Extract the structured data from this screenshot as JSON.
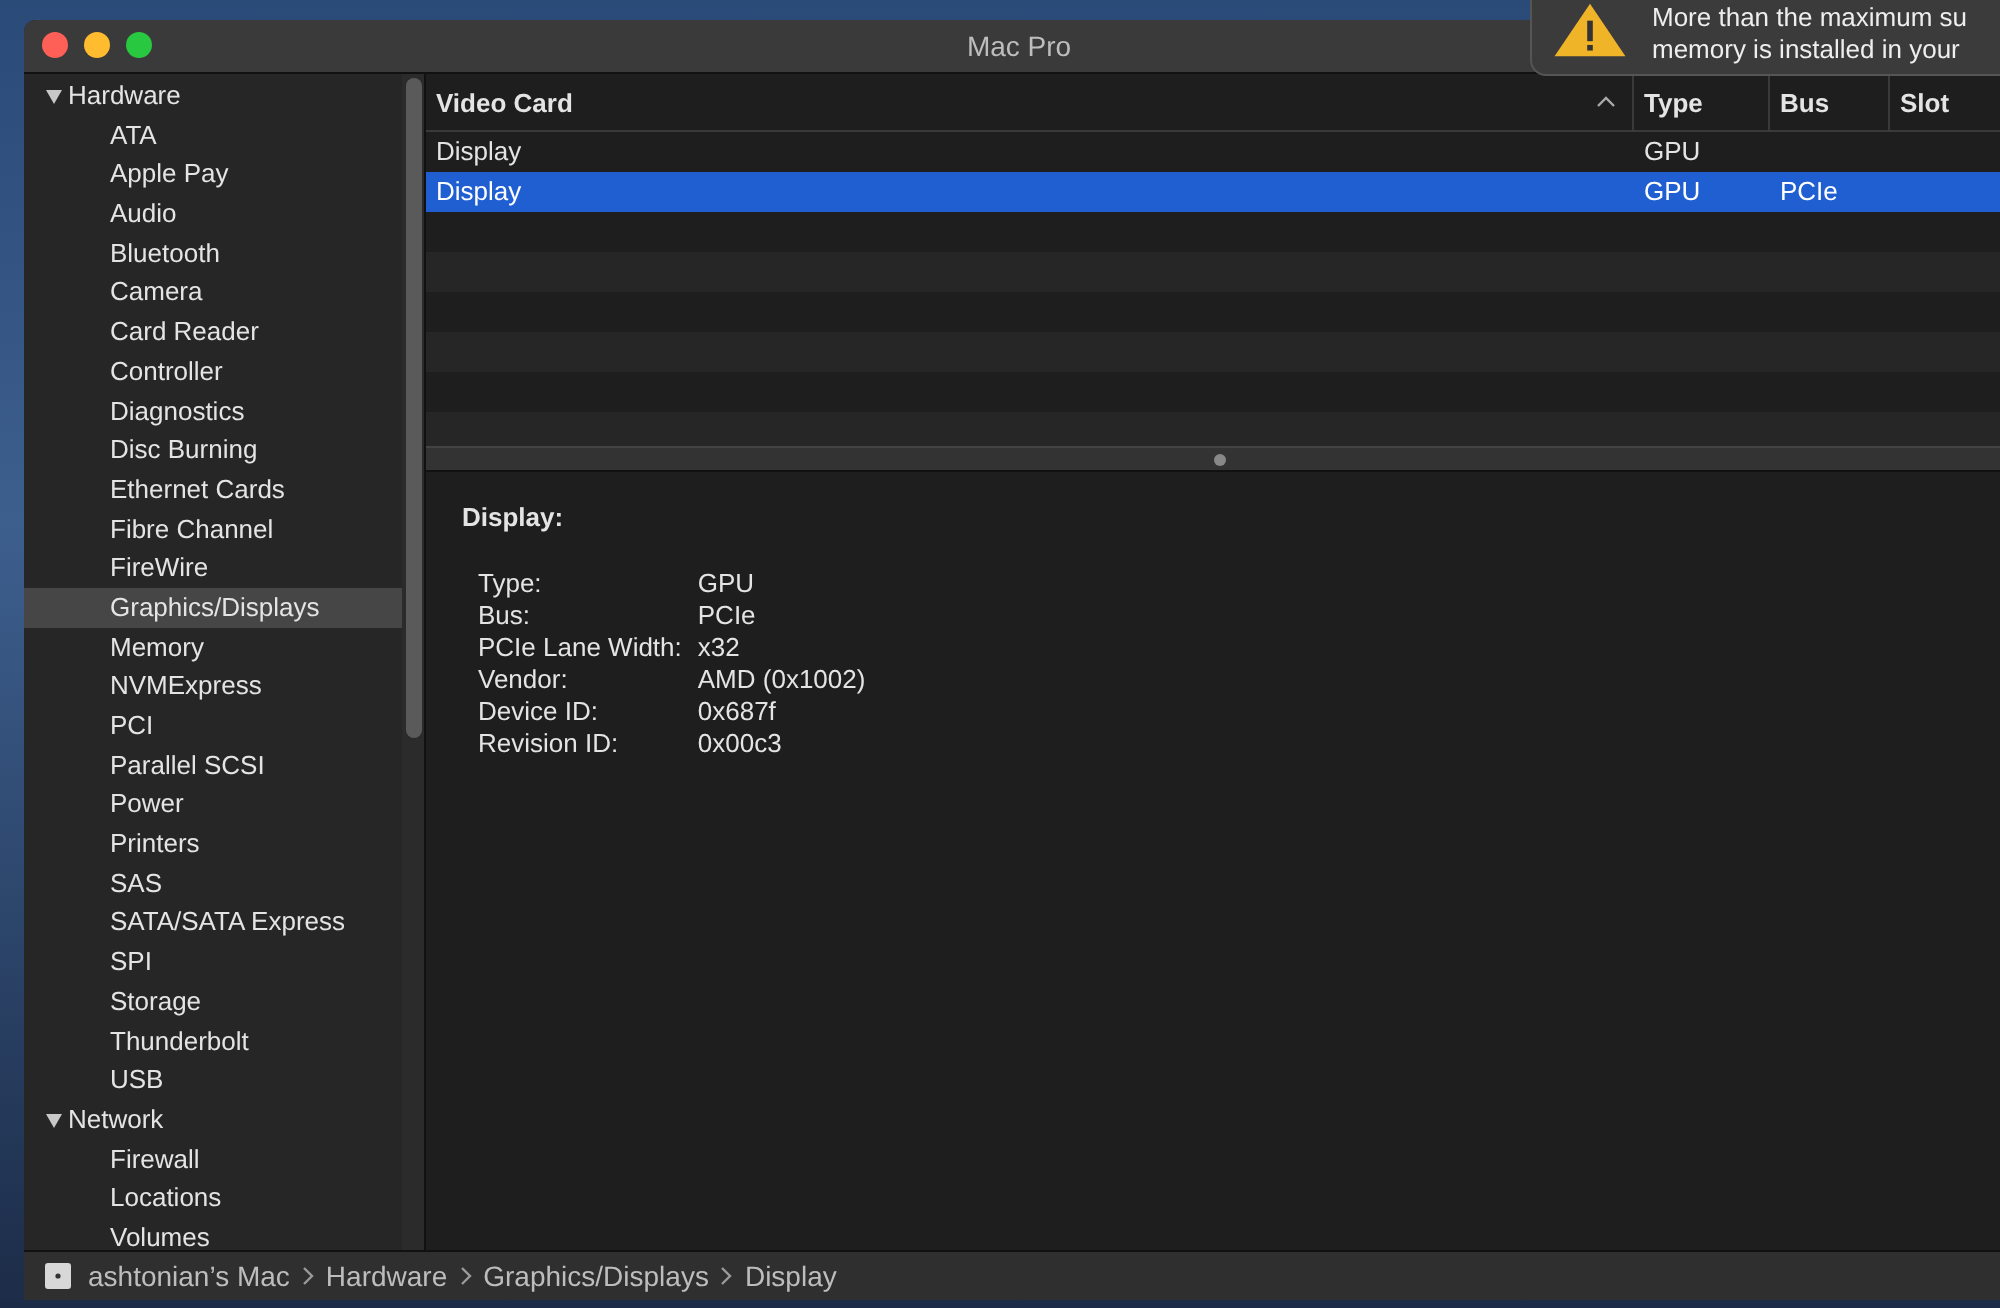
{
  "window": {
    "title": "Mac Pro"
  },
  "notification": {
    "lines": [
      "More than the maximum su",
      "memory is installed in your"
    ]
  },
  "sidebar": {
    "items": [
      {
        "label": "Hardware",
        "expanded": true,
        "selected": false,
        "children": [
          {
            "label": "ATA",
            "selected": false
          },
          {
            "label": "Apple Pay",
            "selected": false
          },
          {
            "label": "Audio",
            "selected": false
          },
          {
            "label": "Bluetooth",
            "selected": false
          },
          {
            "label": "Camera",
            "selected": false
          },
          {
            "label": "Card Reader",
            "selected": false
          },
          {
            "label": "Controller",
            "selected": false
          },
          {
            "label": "Diagnostics",
            "selected": false
          },
          {
            "label": "Disc Burning",
            "selected": false
          },
          {
            "label": "Ethernet Cards",
            "selected": false
          },
          {
            "label": "Fibre Channel",
            "selected": false
          },
          {
            "label": "FireWire",
            "selected": false
          },
          {
            "label": "Graphics/Displays",
            "selected": true
          },
          {
            "label": "Memory",
            "selected": false
          },
          {
            "label": "NVMExpress",
            "selected": false
          },
          {
            "label": "PCI",
            "selected": false
          },
          {
            "label": "Parallel SCSI",
            "selected": false
          },
          {
            "label": "Power",
            "selected": false
          },
          {
            "label": "Printers",
            "selected": false
          },
          {
            "label": "SAS",
            "selected": false
          },
          {
            "label": "SATA/SATA Express",
            "selected": false
          },
          {
            "label": "SPI",
            "selected": false
          },
          {
            "label": "Storage",
            "selected": false
          },
          {
            "label": "Thunderbolt",
            "selected": false
          },
          {
            "label": "USB",
            "selected": false
          }
        ]
      },
      {
        "label": "Network",
        "expanded": true,
        "selected": false,
        "children": [
          {
            "label": "Firewall",
            "selected": false
          },
          {
            "label": "Locations",
            "selected": false
          },
          {
            "label": "Volumes",
            "selected": false
          }
        ]
      }
    ]
  },
  "table": {
    "columns": [
      {
        "label": "Video Card",
        "sorted": true
      },
      {
        "label": "Type",
        "sorted": false
      },
      {
        "label": "Bus",
        "sorted": false
      },
      {
        "label": "Slot",
        "sorted": false
      }
    ],
    "rows": [
      {
        "cells": [
          "Display",
          "GPU",
          "",
          ""
        ],
        "selected": false
      },
      {
        "cells": [
          "Display",
          "GPU",
          "PCIe",
          ""
        ],
        "selected": true
      }
    ]
  },
  "detail": {
    "title": "Display:",
    "fields": [
      {
        "label": "Type:",
        "value": "GPU"
      },
      {
        "label": "Bus:",
        "value": "PCIe"
      },
      {
        "label": "PCIe Lane Width:",
        "value": "x32"
      },
      {
        "label": "Vendor:",
        "value": "AMD (0x1002)"
      },
      {
        "label": "Device ID:",
        "value": "0x687f"
      },
      {
        "label": "Revision ID:",
        "value": "0x00c3"
      }
    ]
  },
  "status_bar": {
    "path": [
      "ashtonian’s Mac",
      "Hardware",
      "Graphics/Displays",
      "Display"
    ]
  }
}
